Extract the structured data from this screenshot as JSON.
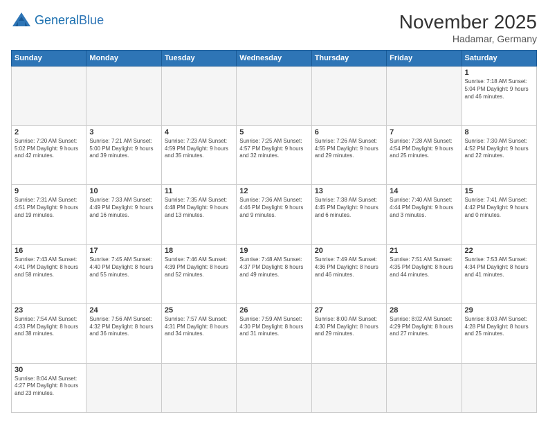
{
  "header": {
    "logo_general": "General",
    "logo_blue": "Blue",
    "month_title": "November 2025",
    "location": "Hadamar, Germany"
  },
  "weekdays": [
    "Sunday",
    "Monday",
    "Tuesday",
    "Wednesday",
    "Thursday",
    "Friday",
    "Saturday"
  ],
  "weeks": [
    [
      {
        "day": "",
        "info": ""
      },
      {
        "day": "",
        "info": ""
      },
      {
        "day": "",
        "info": ""
      },
      {
        "day": "",
        "info": ""
      },
      {
        "day": "",
        "info": ""
      },
      {
        "day": "",
        "info": ""
      },
      {
        "day": "1",
        "info": "Sunrise: 7:18 AM\nSunset: 5:04 PM\nDaylight: 9 hours\nand 46 minutes."
      }
    ],
    [
      {
        "day": "2",
        "info": "Sunrise: 7:20 AM\nSunset: 5:02 PM\nDaylight: 9 hours\nand 42 minutes."
      },
      {
        "day": "3",
        "info": "Sunrise: 7:21 AM\nSunset: 5:00 PM\nDaylight: 9 hours\nand 39 minutes."
      },
      {
        "day": "4",
        "info": "Sunrise: 7:23 AM\nSunset: 4:59 PM\nDaylight: 9 hours\nand 35 minutes."
      },
      {
        "day": "5",
        "info": "Sunrise: 7:25 AM\nSunset: 4:57 PM\nDaylight: 9 hours\nand 32 minutes."
      },
      {
        "day": "6",
        "info": "Sunrise: 7:26 AM\nSunset: 4:55 PM\nDaylight: 9 hours\nand 29 minutes."
      },
      {
        "day": "7",
        "info": "Sunrise: 7:28 AM\nSunset: 4:54 PM\nDaylight: 9 hours\nand 25 minutes."
      },
      {
        "day": "8",
        "info": "Sunrise: 7:30 AM\nSunset: 4:52 PM\nDaylight: 9 hours\nand 22 minutes."
      }
    ],
    [
      {
        "day": "9",
        "info": "Sunrise: 7:31 AM\nSunset: 4:51 PM\nDaylight: 9 hours\nand 19 minutes."
      },
      {
        "day": "10",
        "info": "Sunrise: 7:33 AM\nSunset: 4:49 PM\nDaylight: 9 hours\nand 16 minutes."
      },
      {
        "day": "11",
        "info": "Sunrise: 7:35 AM\nSunset: 4:48 PM\nDaylight: 9 hours\nand 13 minutes."
      },
      {
        "day": "12",
        "info": "Sunrise: 7:36 AM\nSunset: 4:46 PM\nDaylight: 9 hours\nand 9 minutes."
      },
      {
        "day": "13",
        "info": "Sunrise: 7:38 AM\nSunset: 4:45 PM\nDaylight: 9 hours\nand 6 minutes."
      },
      {
        "day": "14",
        "info": "Sunrise: 7:40 AM\nSunset: 4:44 PM\nDaylight: 9 hours\nand 3 minutes."
      },
      {
        "day": "15",
        "info": "Sunrise: 7:41 AM\nSunset: 4:42 PM\nDaylight: 9 hours\nand 0 minutes."
      }
    ],
    [
      {
        "day": "16",
        "info": "Sunrise: 7:43 AM\nSunset: 4:41 PM\nDaylight: 8 hours\nand 58 minutes."
      },
      {
        "day": "17",
        "info": "Sunrise: 7:45 AM\nSunset: 4:40 PM\nDaylight: 8 hours\nand 55 minutes."
      },
      {
        "day": "18",
        "info": "Sunrise: 7:46 AM\nSunset: 4:39 PM\nDaylight: 8 hours\nand 52 minutes."
      },
      {
        "day": "19",
        "info": "Sunrise: 7:48 AM\nSunset: 4:37 PM\nDaylight: 8 hours\nand 49 minutes."
      },
      {
        "day": "20",
        "info": "Sunrise: 7:49 AM\nSunset: 4:36 PM\nDaylight: 8 hours\nand 46 minutes."
      },
      {
        "day": "21",
        "info": "Sunrise: 7:51 AM\nSunset: 4:35 PM\nDaylight: 8 hours\nand 44 minutes."
      },
      {
        "day": "22",
        "info": "Sunrise: 7:53 AM\nSunset: 4:34 PM\nDaylight: 8 hours\nand 41 minutes."
      }
    ],
    [
      {
        "day": "23",
        "info": "Sunrise: 7:54 AM\nSunset: 4:33 PM\nDaylight: 8 hours\nand 38 minutes."
      },
      {
        "day": "24",
        "info": "Sunrise: 7:56 AM\nSunset: 4:32 PM\nDaylight: 8 hours\nand 36 minutes."
      },
      {
        "day": "25",
        "info": "Sunrise: 7:57 AM\nSunset: 4:31 PM\nDaylight: 8 hours\nand 34 minutes."
      },
      {
        "day": "26",
        "info": "Sunrise: 7:59 AM\nSunset: 4:30 PM\nDaylight: 8 hours\nand 31 minutes."
      },
      {
        "day": "27",
        "info": "Sunrise: 8:00 AM\nSunset: 4:30 PM\nDaylight: 8 hours\nand 29 minutes."
      },
      {
        "day": "28",
        "info": "Sunrise: 8:02 AM\nSunset: 4:29 PM\nDaylight: 8 hours\nand 27 minutes."
      },
      {
        "day": "29",
        "info": "Sunrise: 8:03 AM\nSunset: 4:28 PM\nDaylight: 8 hours\nand 25 minutes."
      }
    ],
    [
      {
        "day": "30",
        "info": "Sunrise: 8:04 AM\nSunset: 4:27 PM\nDaylight: 8 hours\nand 23 minutes."
      },
      {
        "day": "",
        "info": ""
      },
      {
        "day": "",
        "info": ""
      },
      {
        "day": "",
        "info": ""
      },
      {
        "day": "",
        "info": ""
      },
      {
        "day": "",
        "info": ""
      },
      {
        "day": "",
        "info": ""
      }
    ]
  ]
}
